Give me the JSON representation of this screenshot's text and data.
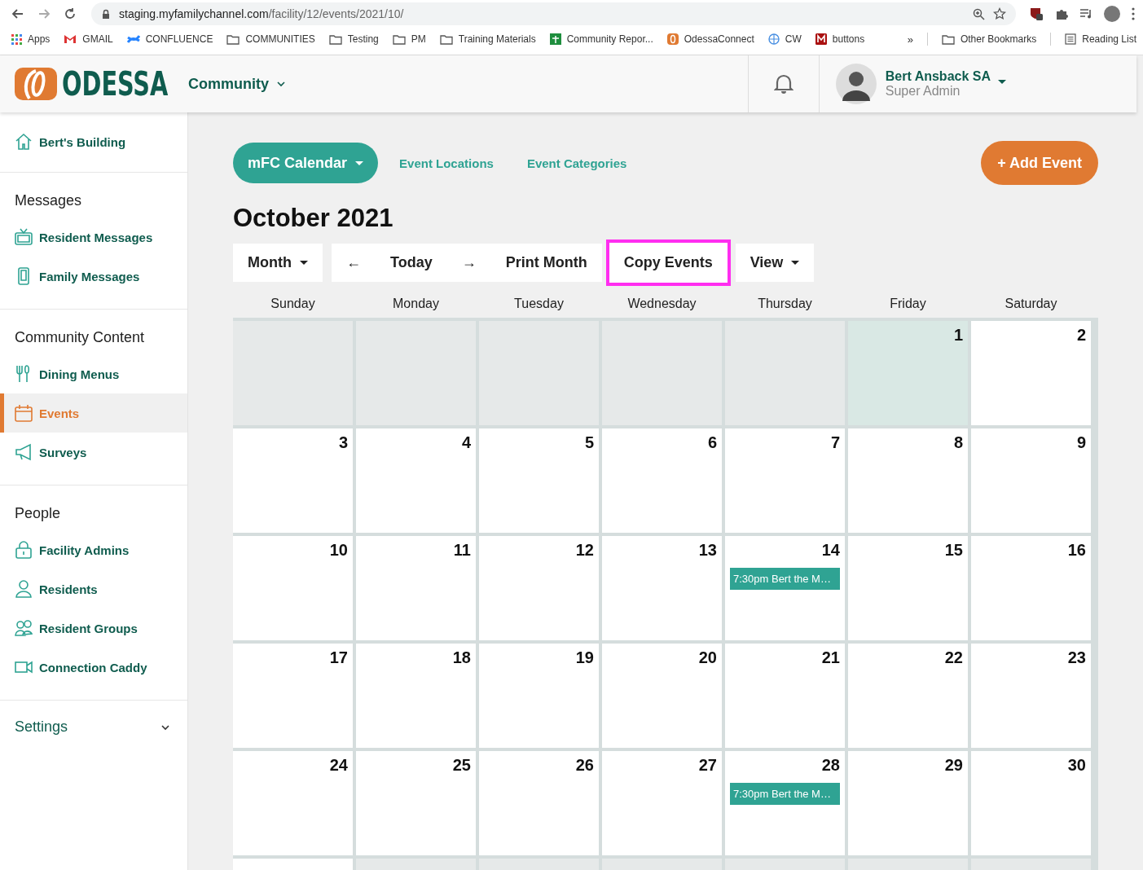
{
  "browser": {
    "url_host": "staging.myfamilychannel.com",
    "url_path": "/facility/12/events/2021/10/",
    "bookmarks": [
      {
        "label": "Apps",
        "kind": "apps"
      },
      {
        "label": "GMAIL",
        "kind": "gmail"
      },
      {
        "label": "CONFLUENCE",
        "kind": "confluence"
      },
      {
        "label": "COMMUNITIES",
        "kind": "folder"
      },
      {
        "label": "Testing",
        "kind": "folder"
      },
      {
        "label": "PM",
        "kind": "folder"
      },
      {
        "label": "Training Materials",
        "kind": "folder"
      },
      {
        "label": "Community Repor...",
        "kind": "sheet"
      },
      {
        "label": "OdessaConnect",
        "kind": "odessa"
      },
      {
        "label": "CW",
        "kind": "globe"
      },
      {
        "label": "buttons",
        "kind": "m"
      }
    ],
    "overflow": "»",
    "other": {
      "label": "Other Bookmarks",
      "kind": "folder"
    },
    "reading": {
      "label": "Reading List",
      "kind": "list"
    }
  },
  "header": {
    "logo": "ODESSA",
    "switcher": "Community",
    "user_name": "Bert Ansback SA",
    "user_role": "Super Admin"
  },
  "sidebar": {
    "home": {
      "label": "Bert's Building",
      "kind": "home"
    },
    "sections": [
      {
        "heading": "Messages",
        "items": [
          {
            "label": "Resident Messages",
            "kind": "tv",
            "selected": false
          },
          {
            "label": "Family Messages",
            "kind": "phone",
            "selected": false
          }
        ]
      },
      {
        "heading": "Community Content",
        "items": [
          {
            "label": "Dining Menus",
            "kind": "utensils",
            "selected": false
          },
          {
            "label": "Events",
            "kind": "calendar",
            "selected": true
          },
          {
            "label": "Surveys",
            "kind": "megaphone",
            "selected": false
          }
        ]
      },
      {
        "heading": "People",
        "items": [
          {
            "label": "Facility Admins",
            "kind": "lock",
            "selected": false
          },
          {
            "label": "Residents",
            "kind": "person",
            "selected": false
          },
          {
            "label": "Resident Groups",
            "kind": "group",
            "selected": false
          },
          {
            "label": "Connection Caddy",
            "kind": "video",
            "selected": false
          }
        ]
      }
    ],
    "settings": {
      "label": "Settings",
      "expanded": false
    }
  },
  "top_nav": {
    "calendar_menu": "mFC Calendar",
    "links": [
      "Event Locations",
      "Event Categories"
    ],
    "add_button": "+ Add Event"
  },
  "month_title": "October 2021",
  "toolbar": [
    {
      "label": "Month",
      "kind": "dropdown",
      "highlighted": false
    },
    {
      "label": "←",
      "kind": "arrow",
      "highlighted": false
    },
    {
      "label": "Today",
      "kind": "plain",
      "highlighted": false
    },
    {
      "label": "→",
      "kind": "arrow",
      "highlighted": false
    },
    {
      "label": "Print Month",
      "kind": "plain",
      "highlighted": false
    },
    {
      "label": "Copy Events",
      "kind": "plain",
      "highlighted": true
    },
    {
      "label": "View",
      "kind": "dropdown",
      "highlighted": false
    }
  ],
  "weekdays": [
    "Sunday",
    "Monday",
    "Tuesday",
    "Wednesday",
    "Thursday",
    "Friday",
    "Saturday"
  ],
  "weeks": [
    [
      {
        "in_month": false
      },
      {
        "in_month": false
      },
      {
        "in_month": false
      },
      {
        "in_month": false
      },
      {
        "in_month": false
      },
      {
        "day": "1",
        "in_month": true,
        "today": true
      },
      {
        "day": "2",
        "in_month": true
      }
    ],
    [
      {
        "day": "3",
        "in_month": true
      },
      {
        "day": "4",
        "in_month": true
      },
      {
        "day": "5",
        "in_month": true
      },
      {
        "day": "6",
        "in_month": true
      },
      {
        "day": "7",
        "in_month": true
      },
      {
        "day": "8",
        "in_month": true
      },
      {
        "day": "9",
        "in_month": true
      }
    ],
    [
      {
        "day": "10",
        "in_month": true
      },
      {
        "day": "11",
        "in_month": true
      },
      {
        "day": "12",
        "in_month": true
      },
      {
        "day": "13",
        "in_month": true
      },
      {
        "day": "14",
        "in_month": true,
        "events": [
          "7:30pm Bert the M…"
        ]
      },
      {
        "day": "15",
        "in_month": true
      },
      {
        "day": "16",
        "in_month": true
      }
    ],
    [
      {
        "day": "17",
        "in_month": true
      },
      {
        "day": "18",
        "in_month": true
      },
      {
        "day": "19",
        "in_month": true
      },
      {
        "day": "20",
        "in_month": true
      },
      {
        "day": "21",
        "in_month": true
      },
      {
        "day": "22",
        "in_month": true
      },
      {
        "day": "23",
        "in_month": true
      }
    ],
    [
      {
        "day": "24",
        "in_month": true
      },
      {
        "day": "25",
        "in_month": true
      },
      {
        "day": "26",
        "in_month": true
      },
      {
        "day": "27",
        "in_month": true
      },
      {
        "day": "28",
        "in_month": true,
        "events": [
          "7:30pm Bert the M…"
        ]
      },
      {
        "day": "29",
        "in_month": true
      },
      {
        "day": "30",
        "in_month": true
      }
    ],
    [
      {
        "in_month": true
      },
      {
        "in_month": false
      },
      {
        "in_month": false
      },
      {
        "in_month": false
      },
      {
        "in_month": false
      },
      {
        "in_month": false
      },
      {
        "in_month": false
      }
    ]
  ]
}
